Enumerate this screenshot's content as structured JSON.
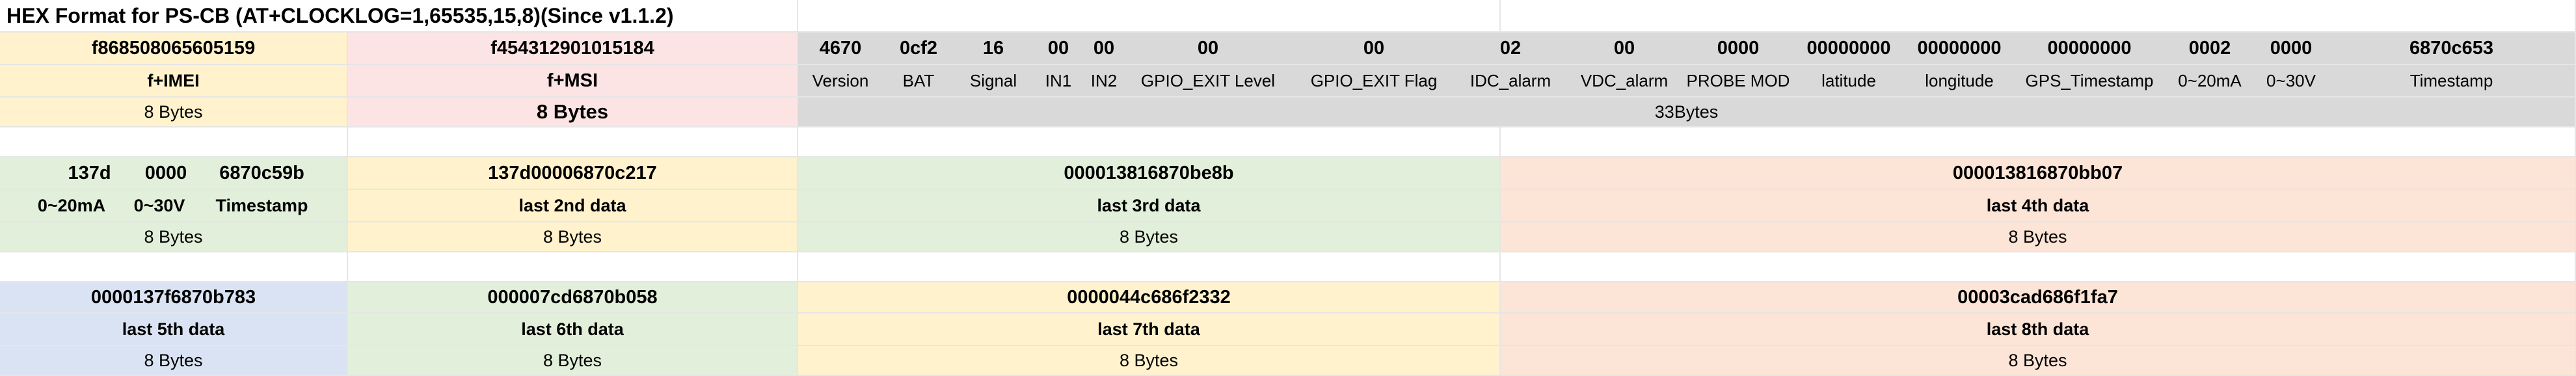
{
  "title": "HEX Format for PS-CB (AT+CLOCKLOG=1,65535,15,8)(Since v1.1.2)",
  "imei": {
    "value": "f868508065605159",
    "label": "f+IMEI",
    "size": "8 Bytes"
  },
  "imsi": {
    "value": "f454312901015184",
    "label": "f+MSI",
    "size": "8 Bytes"
  },
  "payload": {
    "fields": [
      {
        "value": "4670",
        "label": "Version"
      },
      {
        "value": "0cf2",
        "label": "BAT"
      },
      {
        "value": "16",
        "label": "Signal"
      },
      {
        "value": "00",
        "label": "IN1"
      },
      {
        "value": "00",
        "label": "IN2"
      },
      {
        "value": "00",
        "label": "GPIO_EXIT Level"
      },
      {
        "value": "00",
        "label": "GPIO_EXIT Flag"
      },
      {
        "value": "02",
        "label": "IDC_alarm"
      },
      {
        "value": "00",
        "label": "VDC_alarm"
      },
      {
        "value": "0000",
        "label": "PROBE MOD"
      },
      {
        "value": "00000000",
        "label": "latitude"
      },
      {
        "value": "00000000",
        "label": "longitude"
      },
      {
        "value": "00000000",
        "label": "GPS_Timestamp"
      },
      {
        "value": "0002",
        "label": "0~20mA"
      },
      {
        "value": "0000",
        "label": "0~30V"
      },
      {
        "value": "6870c653",
        "label": "Timestamp"
      }
    ],
    "size": "33Bytes"
  },
  "first_data": {
    "values": [
      "137d",
      "0000",
      "6870c59b"
    ],
    "labels": [
      "0~20mA",
      "0~30V",
      "Timestamp"
    ],
    "size": "8 Bytes"
  },
  "row2": [
    {
      "value": "137d00006870c217",
      "label": "last 2nd data",
      "size": "8 Bytes"
    },
    {
      "value": "000013816870be8b",
      "label": "last 3rd data",
      "size": "8 Bytes"
    },
    {
      "value": "000013816870bb07",
      "label": "last 4th data",
      "size": "8 Bytes"
    }
  ],
  "row3": [
    {
      "value": "0000137f6870b783",
      "label": "last 5th data",
      "size": "8 Bytes"
    },
    {
      "value": "000007cd6870b058",
      "label": "last 6th data",
      "size": "8 Bytes"
    },
    {
      "value": "0000044c686f2332",
      "label": "last 7th data",
      "size": "8 Bytes"
    },
    {
      "value": "00003cad686f1fa7",
      "label": "last 8th data",
      "size": "8 Bytes"
    }
  ],
  "colors": {
    "yellow": "#fff2cc",
    "pink": "#fce4e4",
    "grey": "#d9d9d9",
    "green": "#e2efda",
    "orange": "#fce4d6",
    "blue": "#dae3f3"
  }
}
